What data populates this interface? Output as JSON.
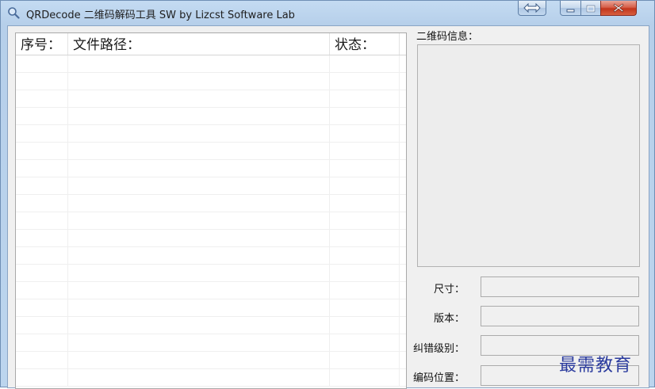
{
  "window": {
    "title": "QRDecode 二维码解码工具 SW by Lizcst Software Lab"
  },
  "list": {
    "columns": [
      {
        "label": "序号："
      },
      {
        "label": "文件路径："
      },
      {
        "label": "状态："
      }
    ],
    "row_count": 19
  },
  "panel": {
    "qr_info_label": "二维码信息：",
    "qr_info_value": "",
    "fields": [
      {
        "label": "尺寸：",
        "value": ""
      },
      {
        "label": "版本：",
        "value": ""
      },
      {
        "label": "纠错级别：",
        "value": ""
      },
      {
        "label": "编码位置：",
        "value": ""
      }
    ]
  },
  "watermark": "最需教育",
  "colors": {
    "title_bar": "#bcd5ee",
    "client_bg": "#f0f0f0",
    "close_button": "#c2351c",
    "watermark": "#2b3b9e"
  }
}
